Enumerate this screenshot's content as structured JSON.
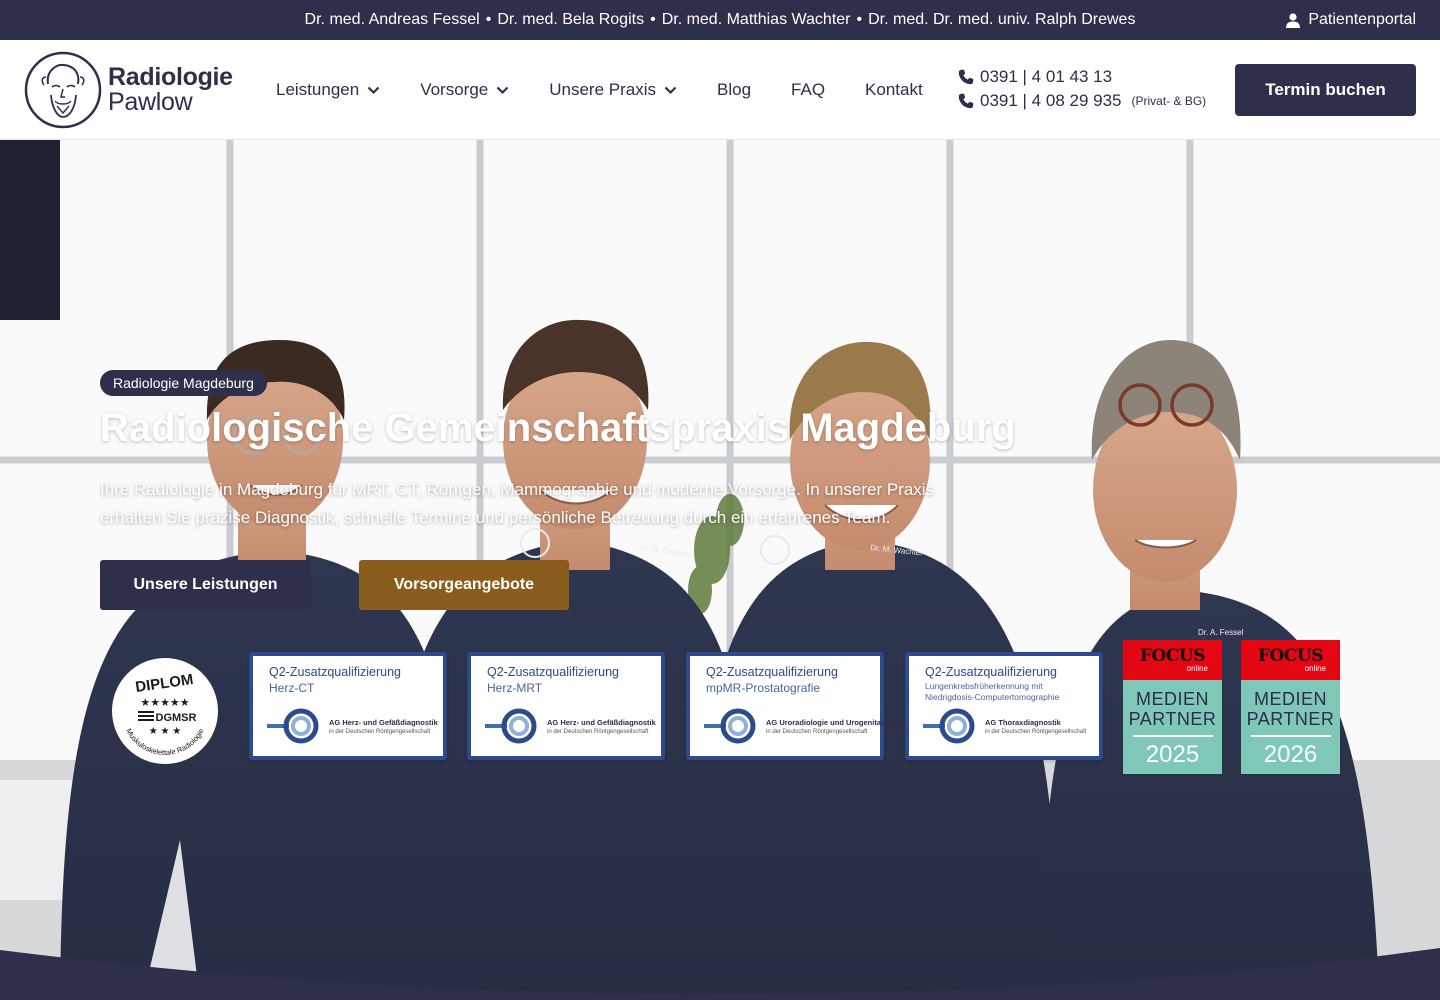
{
  "topbar": {
    "doctors": [
      "Dr. med. Andreas Fessel",
      "Dr. med. Bela Rogits",
      "Dr. med. Matthias Wachter",
      "Dr. med. Dr. med. univ. Ralph Drewes"
    ],
    "separator": "•",
    "portal_label": "Patientenportal",
    "portal_icon": "user-icon"
  },
  "header": {
    "logo_line1": "Radiologie",
    "logo_line2": "Pawlow",
    "nav": [
      {
        "label": "Leistungen",
        "has_dropdown": true
      },
      {
        "label": "Vorsorge",
        "has_dropdown": true
      },
      {
        "label": "Unsere Praxis",
        "has_dropdown": true
      },
      {
        "label": "Blog",
        "has_dropdown": false
      },
      {
        "label": "FAQ",
        "has_dropdown": false
      },
      {
        "label": "Kontakt",
        "has_dropdown": false
      }
    ],
    "phones": [
      {
        "number": "0391 | 4 01 43 13",
        "note": ""
      },
      {
        "number": "0391 | 4 08 29 935",
        "note": "(Privat- & BG)"
      }
    ],
    "cta_label": "Termin buchen"
  },
  "hero": {
    "badge": "Radiologie Magdeburg",
    "title": "Radiologische Gemeinschaftspraxis Magdeburg",
    "text": "Ihre Radiologie in Magdeburg für MRT, CT, Röntgen, Mammographie und moderne Vorsorge. In unserer Praxis erhalten Sie präzise Diagnostik, schnelle Termine und persönliche Betreuung durch ein erfahrenes Team.",
    "button_primary": "Unsere Leistungen",
    "button_secondary": "Vorsorgeangebote",
    "diplom": {
      "top": "DIPLOM",
      "mid": "DGMSR",
      "ring": "Muskuloskelettale Radiologie"
    },
    "certificates": [
      {
        "title": "Q2-Zusatzqualifizierung",
        "subtitle": "Herz-CT",
        "org": "AG Herz- und Gefäßdiagnostik",
        "org_sub": "in der Deutschen Röntgengesellschaft"
      },
      {
        "title": "Q2-Zusatzqualifizierung",
        "subtitle": "Herz-MRT",
        "org": "AG Herz- und Gefäßdiagnostik",
        "org_sub": "in der Deutschen Röntgengesellschaft"
      },
      {
        "title": "Q2-Zusatzqualifizierung",
        "subtitle": "mpMR-Prostatografie",
        "org": "AG Uroradiologie und Urogenitaldiagnostik",
        "org_sub": "in der Deutschen Röntgengesellschaft"
      },
      {
        "title": "Q2-Zusatzqualifizierung",
        "subtitle": "Lungenkrebsfrüherkennung mit Niedrigdosis-Computertomographie",
        "org": "AG Thoraxdiagnostik",
        "org_sub": "in der Deutschen Röntgengesellschaft"
      }
    ],
    "focus_badges": [
      {
        "brand": "FOCUS",
        "online": "online",
        "line1": "MEDIEN",
        "line2": "PARTNER",
        "year": "2025"
      },
      {
        "brand": "FOCUS",
        "online": "online",
        "line1": "MEDIEN",
        "line2": "PARTNER",
        "year": "2026"
      }
    ],
    "shirt_labels": [
      "Dr. R. Drewes",
      "Dr. M. Wachter",
      "Dr. A. Fessel"
    ]
  },
  "colors": {
    "navy": "#2e2f4a",
    "gold": "#8a5d1f",
    "cert_blue": "#2d4a8a",
    "focus_red": "#e30613",
    "focus_teal": "#7fc8b8"
  }
}
